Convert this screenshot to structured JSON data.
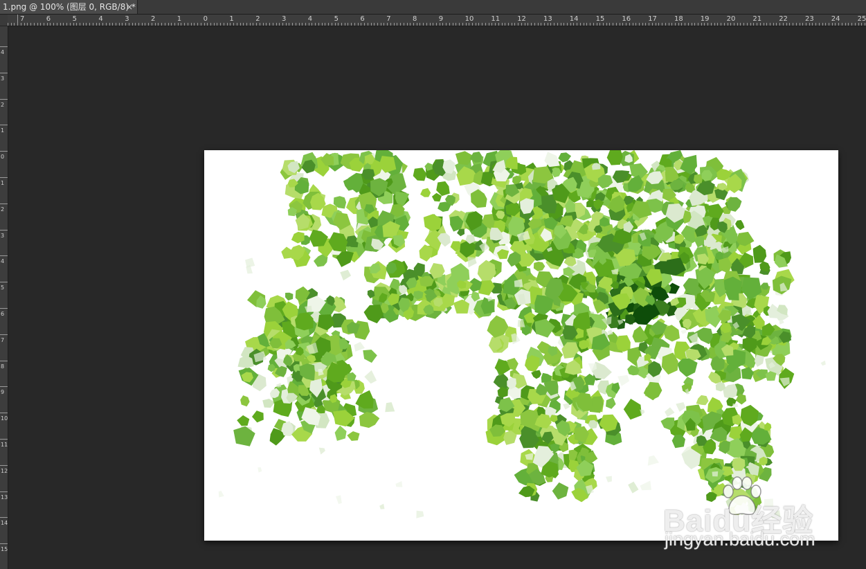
{
  "document_tab": {
    "title": "1.png @ 100% (图层 0, RGB/8) *",
    "close_glyph": "×"
  },
  "rulers": {
    "horizontal_labels": [
      "7",
      "6",
      "5",
      "4",
      "3",
      "2",
      "1",
      "0",
      "1",
      "2",
      "3",
      "4",
      "5",
      "6",
      "7",
      "8",
      "9",
      "10",
      "11",
      "12",
      "13",
      "14",
      "15",
      "16",
      "17",
      "18",
      "19",
      "20",
      "21",
      "22",
      "23",
      "24",
      "25"
    ],
    "vertical_labels": [
      "4",
      "3",
      "2",
      "1",
      "0",
      "1",
      "2",
      "3",
      "4",
      "5",
      "6",
      "7",
      "8",
      "9",
      "10",
      "11",
      "12",
      "13",
      "14",
      "15"
    ]
  },
  "watermark": {
    "brand": "Baidu经验",
    "url": "jingyan.baidu.com",
    "logo_icon": "paw-icon"
  },
  "colors": {
    "workspace": "#282828",
    "ruler": "#3d3d3d",
    "canvas": "#ffffff",
    "foliage_light": "#9bd23a",
    "foliage_mid": "#5faa1e",
    "foliage_dark": "#0e4d0a"
  }
}
